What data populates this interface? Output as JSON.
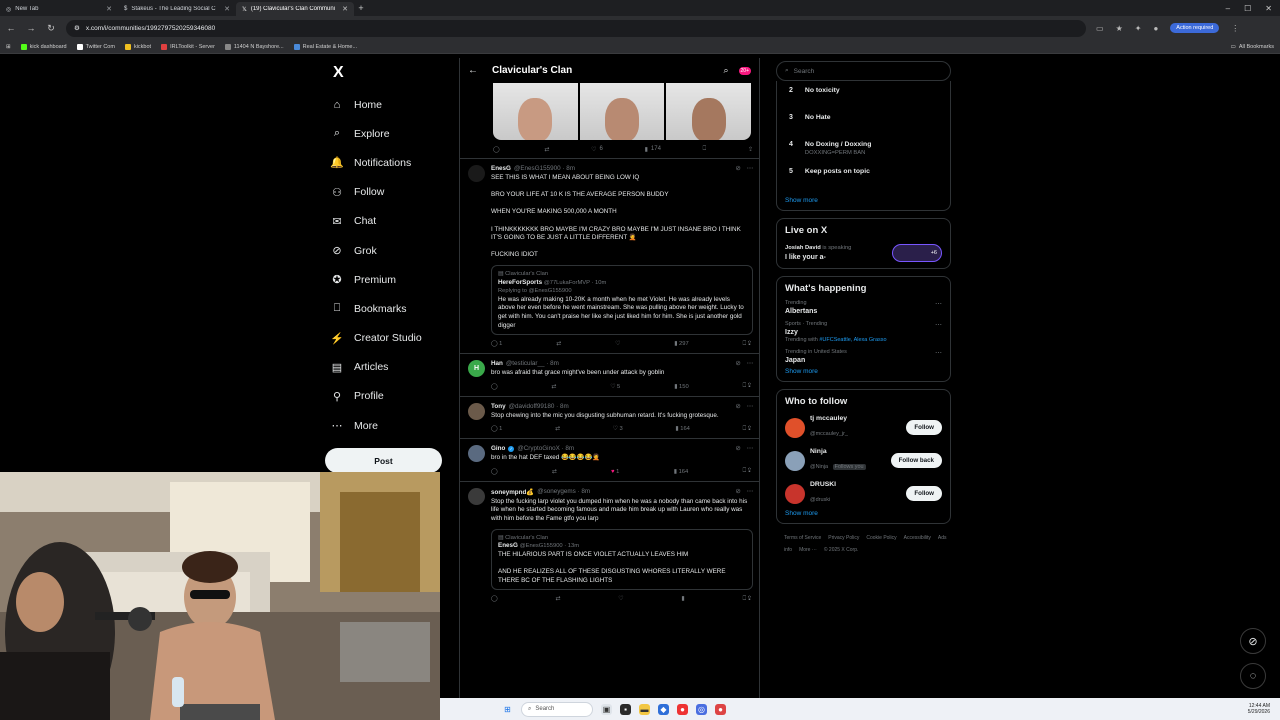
{
  "browser": {
    "tabs": [
      {
        "title": "New Tab",
        "active": false
      },
      {
        "title": "Stakeus - The Leading Social C",
        "active": false
      },
      {
        "title": "(19) Clavicular's Clan Communi",
        "active": true
      }
    ],
    "url": "x.com/i/communities/1992797520259346080",
    "action_required": "Action required",
    "bookmarks": [
      "kick dashboard",
      "Twitter Com",
      "kickbot",
      "IRLToolkit - Server",
      "11404 N Bayshore...",
      "Real Estate & Home..."
    ],
    "all_bookmarks": "All Bookmarks"
  },
  "nav": {
    "logo": "X",
    "items": [
      "Home",
      "Explore",
      "Notifications",
      "Follow",
      "Chat",
      "Grok",
      "Premium",
      "Bookmarks",
      "Creator Studio",
      "Articles",
      "Profile",
      "More"
    ],
    "icons": [
      "home-icon",
      "search-icon",
      "bell-icon",
      "person-plus-icon",
      "mail-icon",
      "grok-icon",
      "verified-icon",
      "bookmark-icon",
      "lightning-icon",
      "article-icon",
      "person-icon",
      "more-icon"
    ],
    "post": "Post"
  },
  "feed": {
    "title": "Clavicular's Clan",
    "badge": "20+",
    "top_post_actions": {
      "replies": "",
      "likes": "6",
      "views": "174"
    },
    "tweets": [
      {
        "name": "EnesG",
        "handle": "@EnesG155900 · 8m",
        "text": "SEE THIS IS WHAT I MEAN ABOUT BEING LOW IQ\n\nBRO YOUR LIFE AT 10 K IS THE AVERAGE PERSON BUDDY\n\nWHEN YOU'RE MAKING 500,000 A MONTH\n\nI THINKKKKKKK BRO MAYBE I'M CRAZY BRO MAYBE I'M JUST INSANE BRO I THINK IT'S GOING TO BE JUST A LITTLE DIFFERENT 🤦\n\nFUCKING IDIOT",
        "quote": {
          "community": "Clavicular's Clan",
          "name": "HereForSports",
          "handle": "@77LukaForMVP · 10m",
          "reply": "Replying to @EnesG155900",
          "text": "He was already making 10-20K a month when he met Violet. He was already levels above her even before he went mainstream. She was pulling above her weight. Lucky to get with him. You can't praise her like she just liked him for him. She is just another gold digger"
        },
        "replies": "1",
        "reposts": "",
        "likes": "",
        "views": "297",
        "avatar_color": "#1a1a1a"
      },
      {
        "name": "Han",
        "handle": "@testicular__ · 8m",
        "text": "bro was afraid that grace might've been under attack by goblin",
        "replies": "",
        "reposts": "",
        "likes": "5",
        "views": "150",
        "avatar_color": "#3aa94a",
        "avatar_letter": "H"
      },
      {
        "name": "Tony",
        "handle": "@davidoff99180 · 8m",
        "text": "Stop chewing into the mic you disgusting subhuman retard. It's fucking grotesque.",
        "replies": "1",
        "reposts": "",
        "likes": "3",
        "views": "164",
        "avatar_color": "#6b5a4a"
      },
      {
        "name": "Gino",
        "handle": "@CryptoGinoX · 8m",
        "text": "bro in the hat DEF taxed 😂😂😂😂🤦",
        "replies": "",
        "reposts": "",
        "likes": "1",
        "views": "164",
        "avatar_color": "#5a6a80",
        "verified": true
      },
      {
        "name": "soneympnd💰",
        "handle": "@soneygems · 8m",
        "text": "Stop the fucking larp violet you dumped him when he was a nobody than came back into his life when he started becoming famous and made him break up with Lauren who really was with him before the Fame gtfo you larp",
        "quote": {
          "community": "Clavicular's Clan",
          "name": "EnesG",
          "handle": "@EnesG155900 · 13m",
          "reply": "",
          "text": "THE HILARIOUS PART IS ONCE VIOLET ACTUALLY LEAVES HIM\n\nAND HE REALIZES ALL OF THESE DISGUSTING WHORES LITERALLY WERE THERE BC OF THE FLASHING LIGHTS"
        },
        "replies": "",
        "reposts": "",
        "likes": "",
        "views": "",
        "avatar_color": "#3a3a3a"
      }
    ]
  },
  "sidebar": {
    "search_placeholder": "Search",
    "rules": [
      {
        "n": "2",
        "t": "No toxicity",
        "s": ""
      },
      {
        "n": "3",
        "t": "No Hate",
        "s": ""
      },
      {
        "n": "4",
        "t": "No Doxing / Doxxing",
        "s": "DOXXING=PERM BAN"
      },
      {
        "n": "5",
        "t": "Keep posts on topic",
        "s": ""
      }
    ],
    "show_more": "Show more",
    "live": {
      "title": "Live on X",
      "host": "Josiah David",
      "status": "is speaking",
      "text": "I like your a-",
      "count": "+6"
    },
    "happening": {
      "title": "What's happening",
      "trends": [
        {
          "context": "Trending",
          "name": "Albertans",
          "with": "",
          "with_tags": ""
        },
        {
          "context": "Sports · Trending",
          "name": "Izzy",
          "with": "Trending with",
          "with_tags": "#UFCSeattle, Alexa Grasso"
        },
        {
          "context": "Trending in United States",
          "name": "Japan",
          "with": "",
          "with_tags": ""
        }
      ]
    },
    "who_to_follow": {
      "title": "Who to follow",
      "users": [
        {
          "name": "tj mccauley",
          "handle": "@mccauley_jr_",
          "button": "Follow",
          "color": "#e0502a"
        },
        {
          "name": "Ninja",
          "handle": "@Ninja",
          "extra": "Follows you",
          "button": "Follow back",
          "color": "#8aa0b8"
        },
        {
          "name": "DRUSKI",
          "handle": "@druski",
          "button": "Follow",
          "color": "#c8342c"
        }
      ]
    },
    "footer": [
      "Terms of Service",
      "Privacy Policy",
      "Cookie Policy",
      "Accessibility",
      "Ads info",
      "More ···",
      "© 2025 X Corp."
    ]
  },
  "taskbar": {
    "search": "Search",
    "time": "12:44 AM",
    "date": "5/29/2026"
  }
}
